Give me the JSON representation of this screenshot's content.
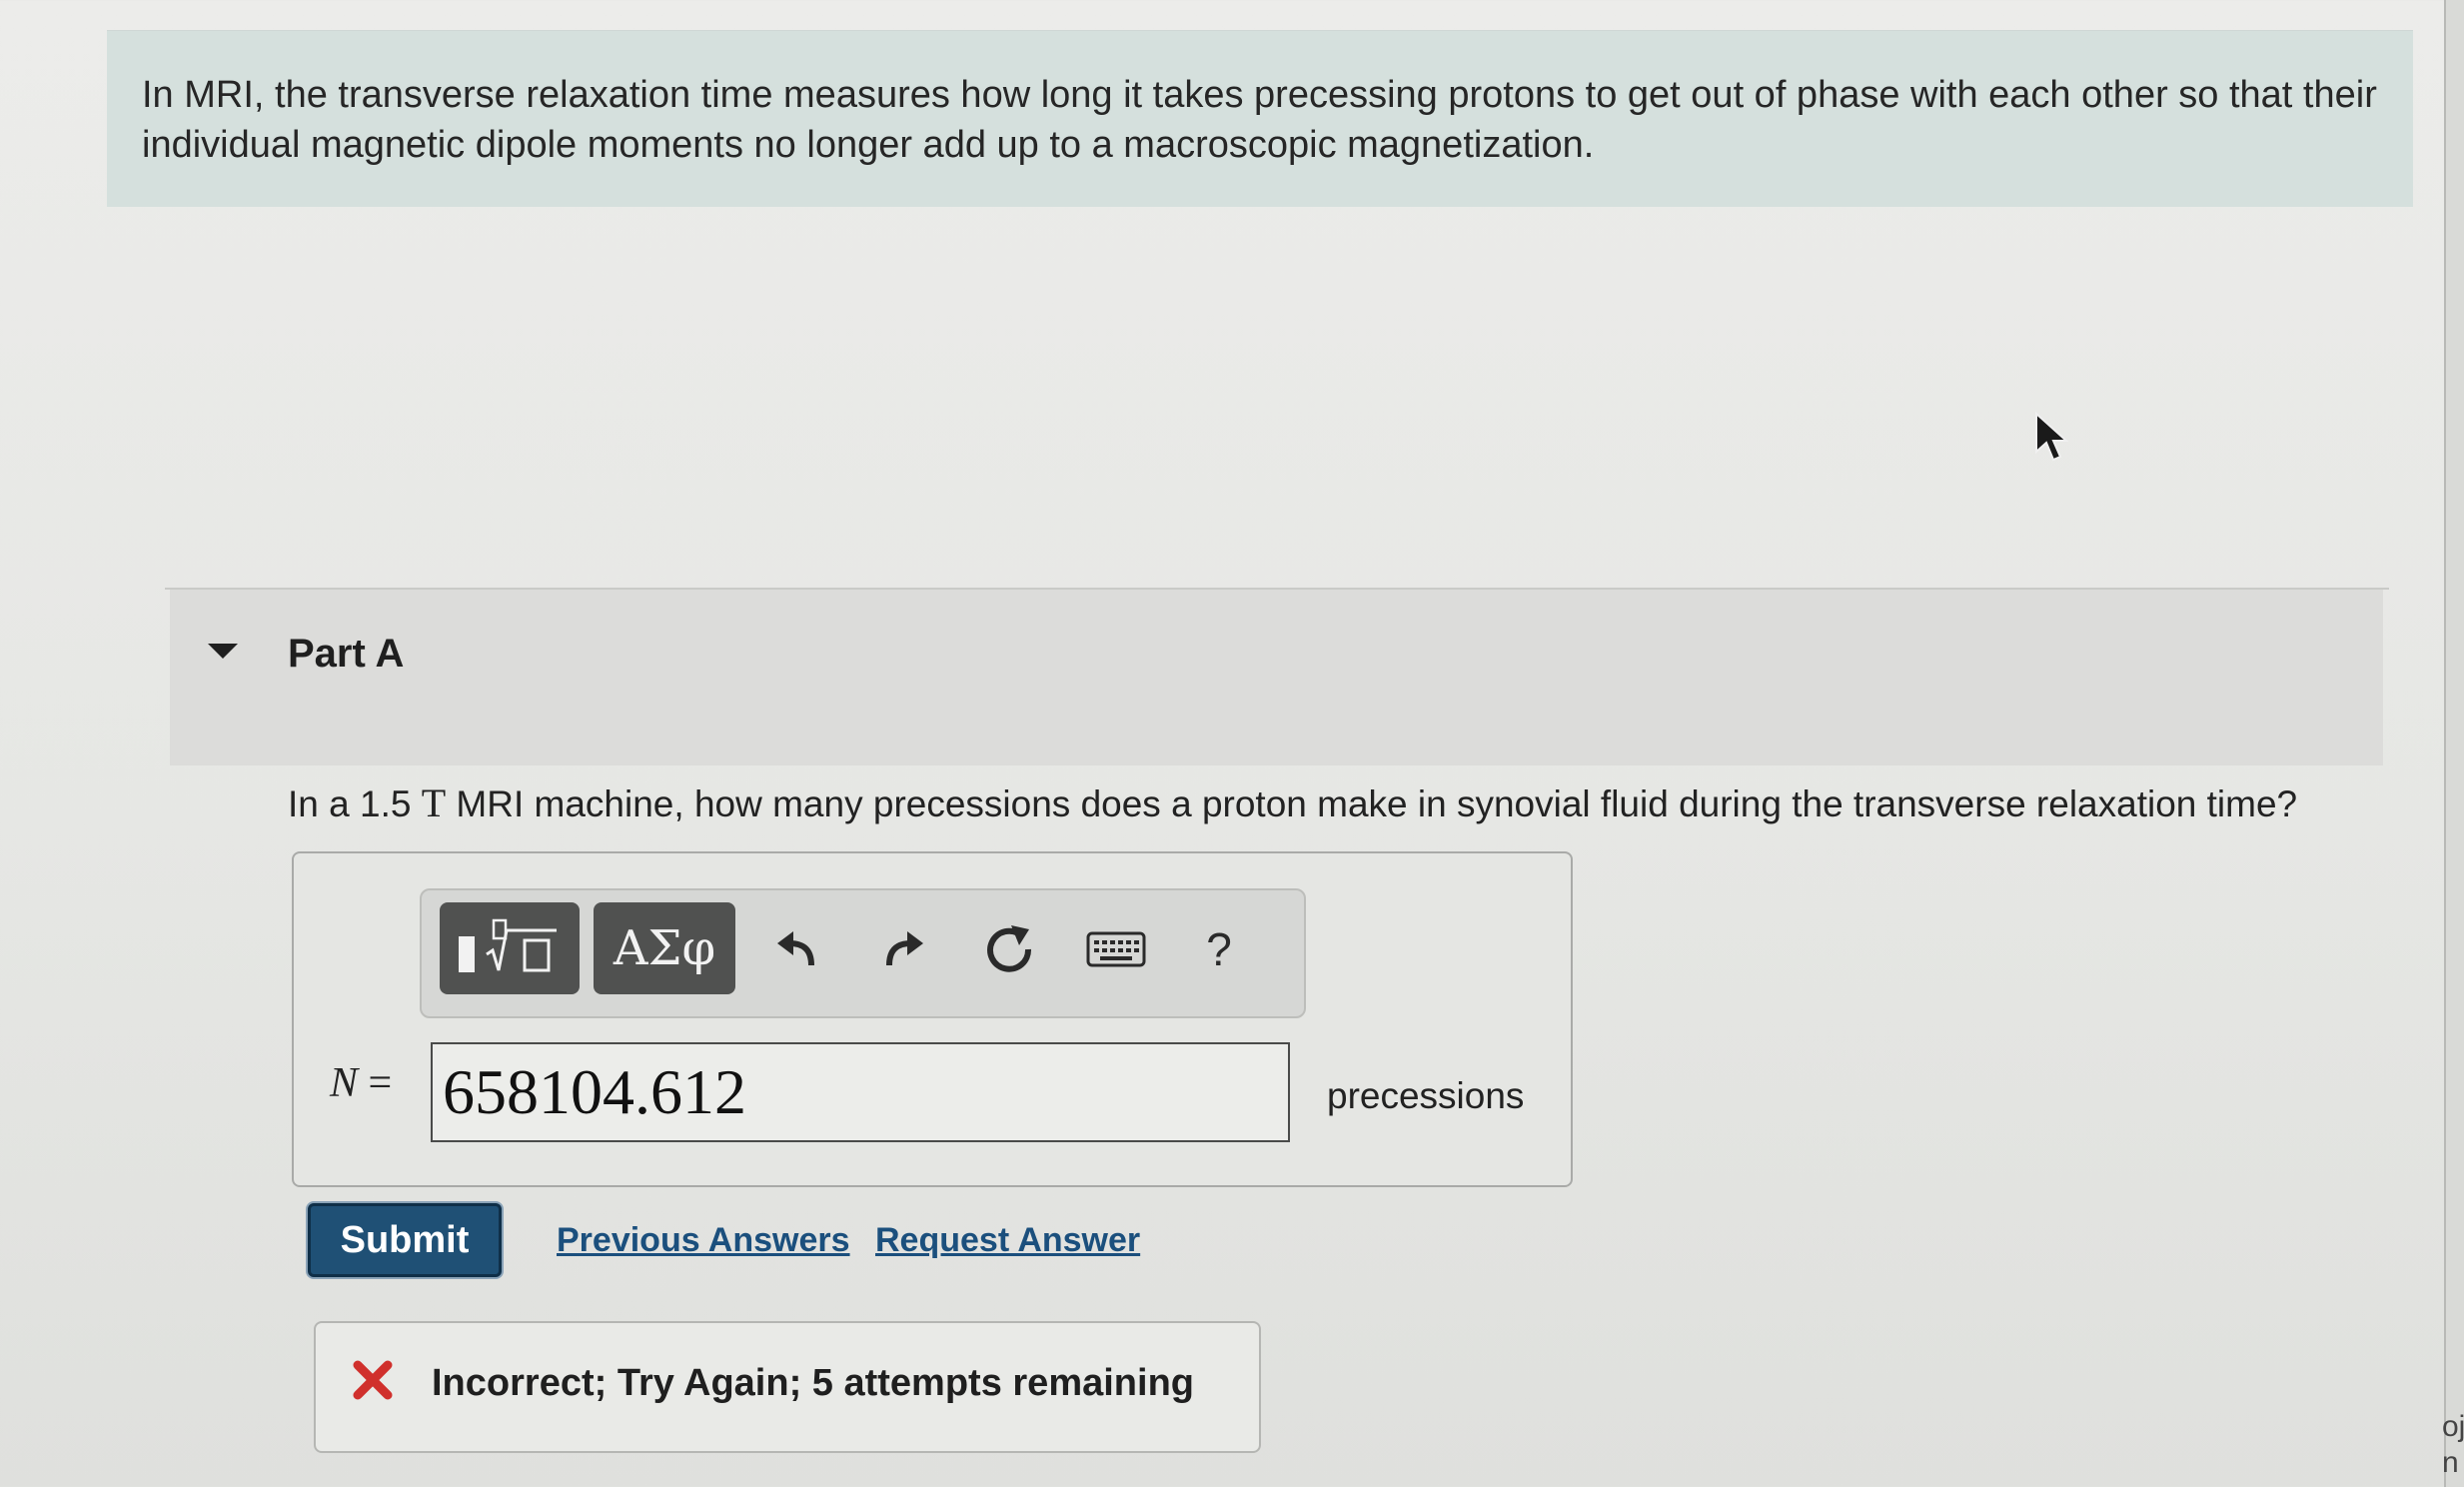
{
  "intro": {
    "text": "In MRI, the transverse relaxation time measures how long it takes precessing protons to get out of phase with each other so that their individual magnetic dipole moments no longer add up to a macroscopic magnetization."
  },
  "part": {
    "title": "Part A",
    "question_before": "In a 1.5 ",
    "question_unit": "T",
    "question_after": " MRI machine, how many precessions does a proton make in synovial fluid during the transverse relaxation time?"
  },
  "toolbar": {
    "symbols_label": "ΑΣφ",
    "help_label": "?"
  },
  "answer": {
    "variable": "N",
    "equals": " =",
    "value": "658104.612",
    "units": "precessions"
  },
  "actions": {
    "submit_label": "Submit",
    "previous_answers_label": "Previous Answers",
    "request_answer_label": "Request Answer"
  },
  "feedback": {
    "text": "Incorrect; Try Again; 5 attempts remaining"
  },
  "edge_fragment": {
    "line1": "oj",
    "line2": "n"
  },
  "colors": {
    "intro_bg": "#d5e0dd",
    "submit_bg": "#1f5075",
    "link": "#1b4f7d",
    "error": "#d0302c"
  }
}
